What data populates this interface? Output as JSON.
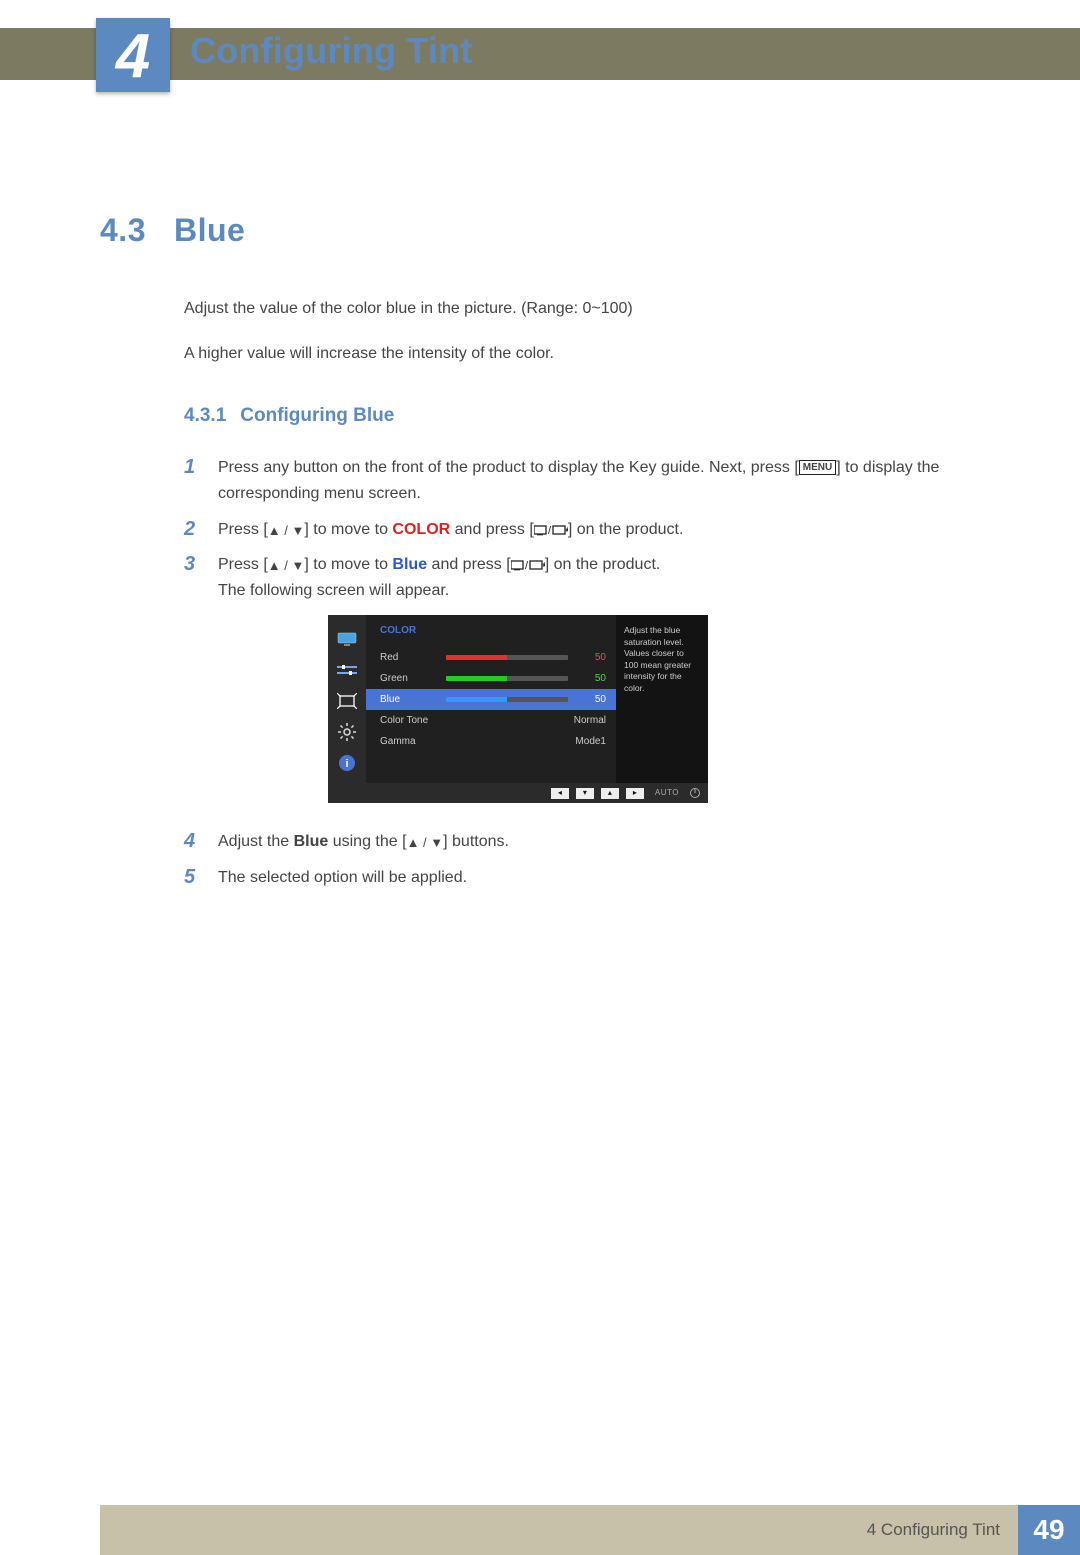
{
  "chapter": {
    "number": "4",
    "title": "Configuring Tint"
  },
  "section": {
    "number": "4.3",
    "title": "Blue"
  },
  "intro": {
    "p1": "Adjust the value of the color blue in the picture. (Range: 0~100)",
    "p2": "A higher value will increase the intensity of the color."
  },
  "subsection": {
    "number": "4.3.1",
    "title": "Configuring Blue"
  },
  "steps": {
    "s1_a": "Press any button on the front of the product to display the Key guide. Next, press [",
    "s1_menu": "MENU",
    "s1_b": "] to display the corresponding menu screen.",
    "s2_a": "Press [",
    "s2_b": "] to move to ",
    "s2_color": "COLOR",
    "s2_c": " and press [",
    "s2_d": "] on the product.",
    "s3_a": "Press [",
    "s3_b": "] to move to ",
    "s3_blue": "Blue",
    "s3_c": " and press [",
    "s3_d": "] on the product.",
    "s3_follow": "The following screen will appear.",
    "s4_a": "Adjust the ",
    "s4_blue": "Blue",
    "s4_b": " using the [",
    "s4_c": "] buttons.",
    "s5": "The selected option will be applied."
  },
  "osd": {
    "title": "COLOR",
    "red_label": "Red",
    "red_val": "50",
    "green_label": "Green",
    "green_val": "50",
    "blue_label": "Blue",
    "blue_val": "50",
    "ct_label": "Color Tone",
    "ct_val": "Normal",
    "gamma_label": "Gamma",
    "gamma_val": "Mode1",
    "help": "Adjust the blue saturation level. Values closer to 100 mean greater intensity for the color.",
    "auto": "AUTO"
  },
  "footer": {
    "label": "4 Configuring Tint",
    "page": "49"
  },
  "colors": {
    "accent": "#5c8ac0",
    "olive": "#7d7a62"
  }
}
